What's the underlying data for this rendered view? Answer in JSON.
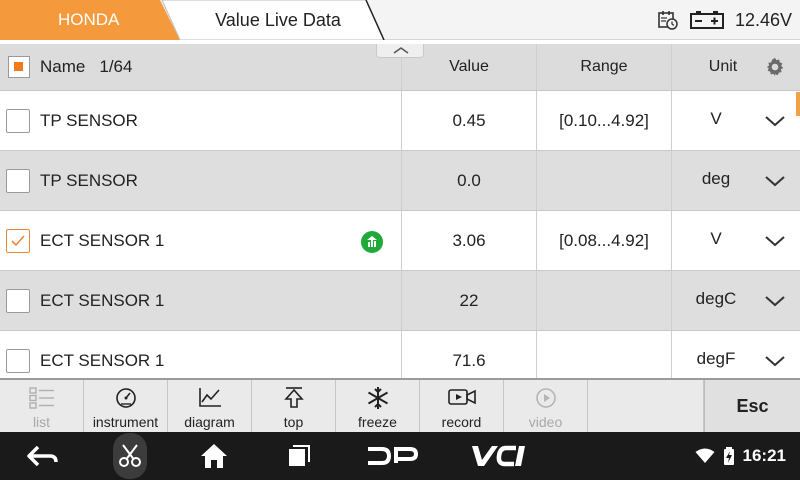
{
  "topbar": {
    "brand": "HONDA",
    "title": "Value Live Data",
    "voltage": "12.46V",
    "brand_color": "#f59a3c",
    "icons": [
      "calendar-clock-icon",
      "battery-icon"
    ]
  },
  "table": {
    "header": {
      "name_label": "Name",
      "count": "1/64",
      "value_label": "Value",
      "range_label": "Range",
      "unit_label": "Unit"
    },
    "rows": [
      {
        "name": "TP SENSOR",
        "value": "0.45",
        "range": "[0.10...4.92]",
        "unit": "V",
        "checked": false
      },
      {
        "name": "TP SENSOR",
        "value": "0.0",
        "range": "",
        "unit": "deg",
        "checked": false
      },
      {
        "name": "ECT SENSOR 1",
        "value": "3.06",
        "range": "[0.08...4.92]",
        "unit": "V",
        "checked": true
      },
      {
        "name": "ECT SENSOR 1",
        "value": "22",
        "range": "",
        "unit": "degC",
        "checked": false
      },
      {
        "name": "ECT SENSOR 1",
        "value": "71.6",
        "range": "",
        "unit": "degF",
        "checked": false
      }
    ]
  },
  "toolbar": {
    "list": "list",
    "instrument": "instrument",
    "diagram": "diagram",
    "top": "top",
    "freeze": "freeze",
    "record": "record",
    "video": "video",
    "esc": "Esc"
  },
  "navbar": {
    "time": "16:21"
  }
}
